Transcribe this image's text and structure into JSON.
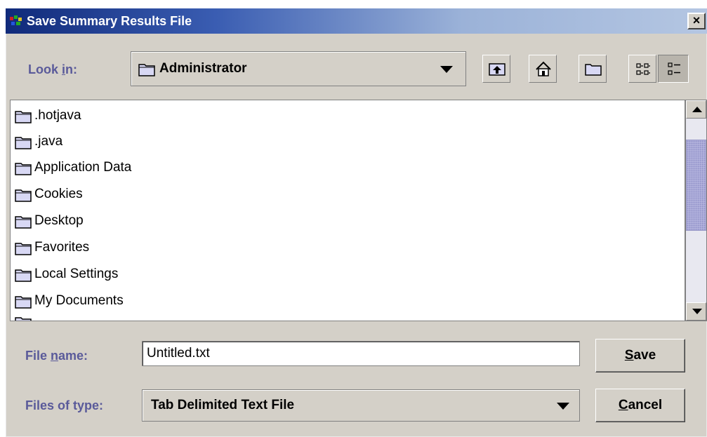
{
  "window": {
    "title": "Save Summary Results File",
    "close_symbol": "×",
    "icon": "java-app-icon"
  },
  "look_in": {
    "label_prefix": "Look ",
    "label_mnemonic": "i",
    "label_suffix": "n:",
    "value": "Administrator"
  },
  "toolbar": {
    "buttons": [
      "up-one-level-icon",
      "home-icon",
      "new-folder-icon",
      "list-view-icon",
      "details-view-icon"
    ]
  },
  "files": [
    {
      "name": ".hotjava",
      "icon": "folder-icon"
    },
    {
      "name": ".java",
      "icon": "folder-icon"
    },
    {
      "name": "Application Data",
      "icon": "folder-icon"
    },
    {
      "name": "Cookies",
      "icon": "folder-icon"
    },
    {
      "name": "Desktop",
      "icon": "folder-icon"
    },
    {
      "name": "Favorites",
      "icon": "folder-icon"
    },
    {
      "name": "Local Settings",
      "icon": "folder-icon"
    },
    {
      "name": "My Documents",
      "icon": "folder-icon"
    }
  ],
  "file_name": {
    "label_prefix": "File ",
    "label_mnemonic": "n",
    "label_suffix": "ame:",
    "value": "Untitled.txt"
  },
  "file_type": {
    "label": "Files of type:",
    "value": "Tab Delimited Text File"
  },
  "buttons": {
    "save_mnemonic": "S",
    "save_rest": "ave",
    "cancel_mnemonic": "C",
    "cancel_rest": "ancel"
  },
  "colors": {
    "title_gradient_start": "#102a7a",
    "title_gradient_end": "#b4c6e2",
    "label_color": "#5a5a9a",
    "panel_bg": "#d4d0c8",
    "scroll_thumb": "#b8b8e0"
  }
}
